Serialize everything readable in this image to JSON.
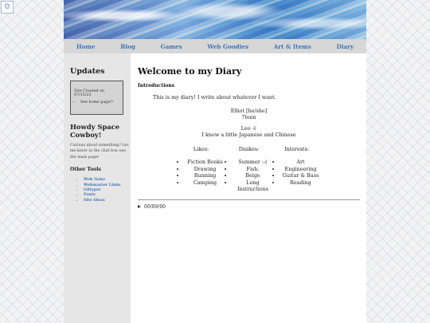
{
  "corner_icon": "site-logo-icon",
  "nav": [
    "Home",
    "Blog",
    "Games",
    "Web Goodies",
    "Art & Items",
    "Diary"
  ],
  "sidebar": {
    "updates_title": "Updates",
    "updates_box": {
      "created": "Site Created on 07/15/23",
      "items": [
        "See home page!!"
      ]
    },
    "howdy_title": "Howdy Space Cowboy!",
    "howdy_text": "Curious about something? Let me know in the chat box one the main page!",
    "tools_title": "Other Tools",
    "tools": [
      "Web Neko",
      "Webmaster Links",
      "Glitypet",
      "Fonts",
      "Site Ideas"
    ]
  },
  "main": {
    "title": "Welcome to my Diary",
    "intro_heading": "Introductions",
    "intro_text": "This is my diary! I write about whatever I want.",
    "name_line": "Elliot [he/she]",
    "age_line": "7teen",
    "zodiac_line": "Leo ♌︎",
    "language_line": "I know a little Japanese and Chinese",
    "likes_title": "Likes:",
    "likes": [
      "Fiction Books",
      "Drawing",
      "Running",
      "Camping"
    ],
    "dislikes_title": "Disikes:",
    "dislikes": [
      "Summer :-(",
      "Fish.",
      "Beige",
      "Long Instructions"
    ],
    "interests_title": "Interests:",
    "interests": [
      "Art",
      "Engineering",
      "Guitar & Bass",
      "Reading"
    ],
    "player_time": "00/00/00"
  }
}
